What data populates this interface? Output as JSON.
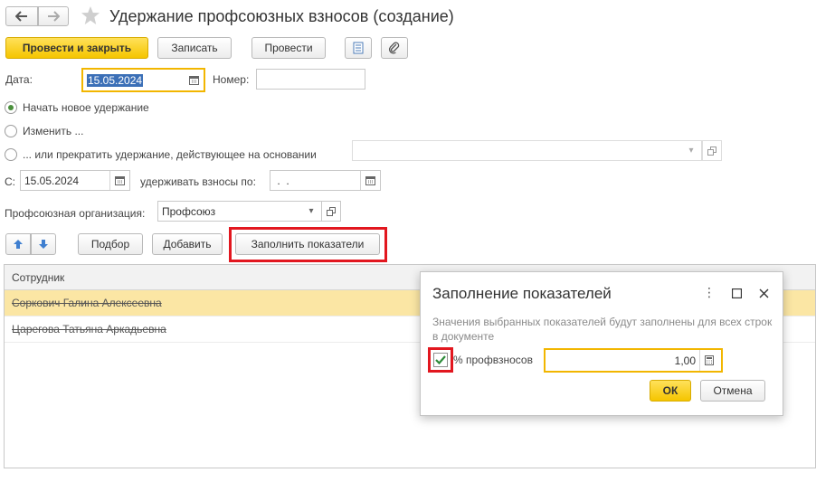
{
  "header": {
    "title": "Удержание профсоюзных взносов (создание)"
  },
  "toolbar": {
    "post_close_label": "Провести и закрыть",
    "save_label": "Записать",
    "post_label": "Провести"
  },
  "form": {
    "date_label": "Дата:",
    "date_value": "15.05.2024",
    "number_label": "Номер:",
    "number_value": "",
    "radio_new_label": "Начать новое удержание",
    "radio_change_label": "Изменить ...",
    "radio_stop_label": "... или прекратить удержание, действующее на основании",
    "basis_value": "",
    "from_label": "С:",
    "from_value": "15.05.2024",
    "until_label": "удерживать взносы по:",
    "until_value": " .  .",
    "org_label": "Профсоюзная организация:",
    "org_value": "Профсоюз"
  },
  "table_toolbar": {
    "pick_label": "Подбор",
    "add_label": "Добавить",
    "fill_label": "Заполнить показатели"
  },
  "table": {
    "column_header": "Сотрудник",
    "rows": [
      "Соркович Галина Алексеевна",
      "Царегова Татьяна Аркадьевна"
    ]
  },
  "dialog": {
    "title": "Заполнение показателей",
    "note": "Значения выбранных показателей будут заполнены для всех строк в документе",
    "indicator_label": "% профвзносов",
    "indicator_value": "1,00",
    "ok_label": "ОК",
    "cancel_label": "Отмена"
  },
  "colors": {
    "accent_yellow": "#f5c500",
    "selected_row": "#fbe6a4",
    "highlight_red": "#e2171f",
    "focus_orange": "#f2b600"
  }
}
